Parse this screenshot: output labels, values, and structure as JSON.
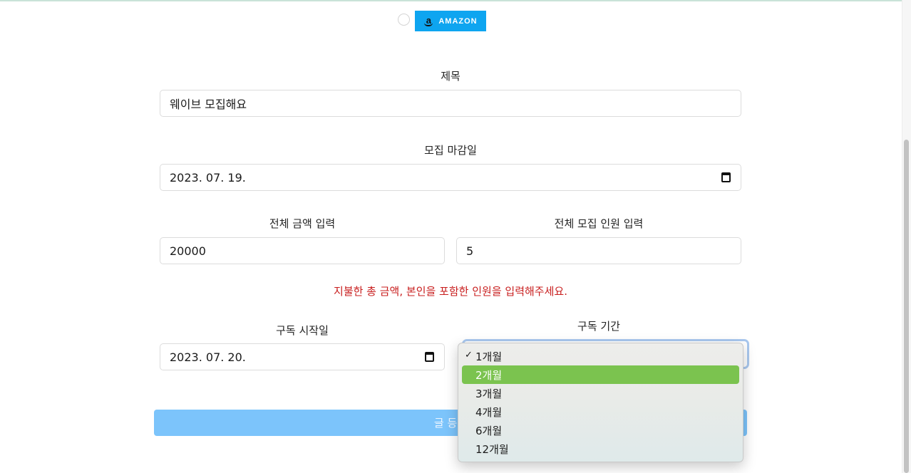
{
  "platform": {
    "selected": false,
    "badge_label": "AMAZON",
    "badge_color": "#0ea5f0",
    "logo_letter": "a"
  },
  "title_section": {
    "label": "제목",
    "value": "웨이브 모집해요"
  },
  "deadline_section": {
    "label": "모집 마감일",
    "value": "2023. 07. 19."
  },
  "amount_section": {
    "label": "전체 금액 입력",
    "value": "20000"
  },
  "people_section": {
    "label": "전체 모집 인원 입력",
    "value": "5"
  },
  "notice": {
    "text": "지불한 총 금액, 본인을 포함한 인원을 입력해주세요.",
    "color": "#c81e1e"
  },
  "start_section": {
    "label": "구독 시작일",
    "value": "2023. 07. 20."
  },
  "period_section": {
    "label": "구독 기간",
    "selected": "1개월",
    "highlighted": "2개월",
    "options": [
      "1개월",
      "2개월",
      "3개월",
      "4개월",
      "6개월",
      "12개월"
    ]
  },
  "submit": {
    "label": "글 등록",
    "color": "#7cc4fb"
  }
}
